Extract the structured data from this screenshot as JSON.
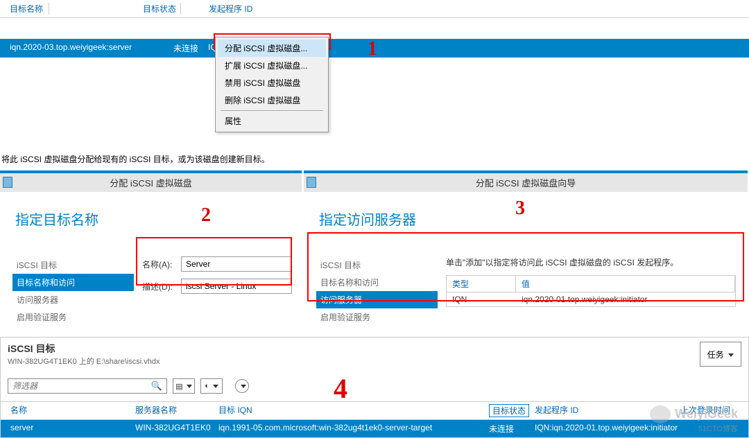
{
  "topTable": {
    "headers": [
      "目标名称",
      "目标状态",
      "发起程序 ID"
    ],
    "row": {
      "name": "iqn.2020-03.top.weiyigeek:server",
      "status": "未连接",
      "initiator": "IQN"
    }
  },
  "contextMenu": {
    "items": [
      {
        "label": "分配 iSCSI 虚拟磁盘...",
        "highlight": true
      },
      {
        "label": "扩展 iSCSI 虚拟磁盘...",
        "highlight": false
      },
      {
        "label": "禁用 iSCSI 虚拟磁盘",
        "highlight": false
      },
      {
        "label": "删除 iSCSI 虚拟磁盘",
        "highlight": false
      }
    ],
    "propsLabel": "属性"
  },
  "instruction": "将此 iSCSI 虚拟磁盘分配给现有的 iSCSI 目标，或为该磁盘创建新目标。",
  "panel2": {
    "title": "分配 iSCSI 虚拟磁盘",
    "heading": "指定目标名称",
    "sidebar": [
      "iSCSI 目标",
      "目标名称和访问",
      "访问服务器",
      "启用验证服务"
    ],
    "selectedIndex": 1,
    "nameLabel": "名称(A):",
    "nameValue": "Server",
    "descLabel": "描述(D):",
    "descValue": "iscsi Server - Linux"
  },
  "panel3": {
    "title": "分配 iSCSI 虚拟磁盘向导",
    "heading": "指定访问服务器",
    "sidebar": [
      "iSCSI 目标",
      "目标名称和访问",
      "访问服务器",
      "启用验证服务"
    ],
    "selectedIndex": 2,
    "info": "单击\"添加\"以指定将访问此 iSCSI 虚拟磁盘的 iSCSI 发起程序。",
    "tableHeaders": [
      "类型",
      "值"
    ],
    "tableRow": [
      "IQN",
      "iqn.2020-01.top.weiyigeek:initiator"
    ]
  },
  "section4": {
    "title": "iSCSI 目标",
    "subtitle": "WIN-382UG4T1EK0 上的 E:\\share\\iscsi.vhdx",
    "tasksLabel": "任务",
    "filterPlaceholder": "筛选器",
    "columns": [
      "名称",
      "服务器名称",
      "目标 IQN",
      "目标状态",
      "发起程序 ID",
      "上次登录时间"
    ],
    "row": {
      "name": "server",
      "server": "WIN-382UG4T1EK0",
      "iqn": "iqn.1991-05.com.microsoft:win-382ug4t1ek0-server-target",
      "status": "未连接",
      "initiator": "IQN:iqn.2020-01.top.weiyigeek:initiator"
    }
  },
  "annotations": {
    "a1": "1",
    "a2": "2",
    "a3": "3",
    "a4": "4"
  },
  "watermark": "WeiyiGeek",
  "watermarkSub": "51CTO博客"
}
